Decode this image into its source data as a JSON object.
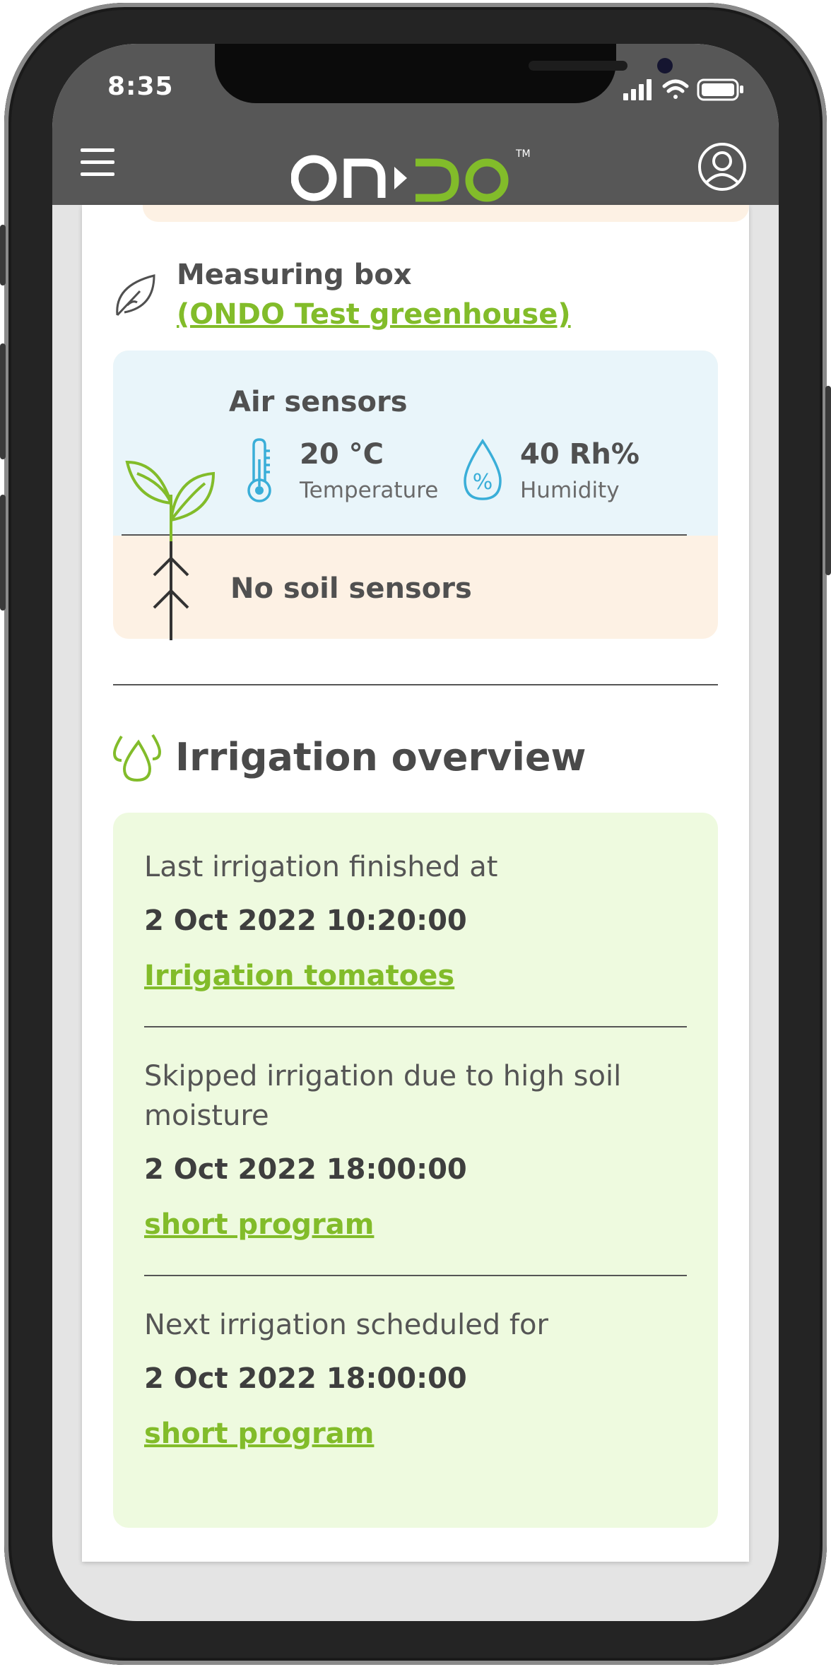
{
  "status_bar": {
    "time": "8:35"
  },
  "header": {
    "logo_text": "ON▸DO™",
    "icons": [
      "hamburger-menu-icon",
      "user-profile-icon"
    ],
    "colors": {
      "bar": "#575757",
      "logo_white": "#ffffff",
      "logo_green": "#82bc2a"
    }
  },
  "measuring_box": {
    "title": "Measuring box",
    "location_link": "(ONDO Test greenhouse)",
    "icon": "leaf-icon"
  },
  "sensors": {
    "air_title": "Air sensors",
    "temperature": {
      "value": "20 °C",
      "label": "Temperature",
      "icon": "thermometer-icon"
    },
    "humidity": {
      "value": "40 Rh%",
      "label": "Humidity",
      "icon": "humidity-drop-icon"
    },
    "soil_text": "No soil sensors",
    "plant_icon": "plant-sprout-icon",
    "colors": {
      "air_bg": "#e9f5fa",
      "soil_bg": "#fdf1e4",
      "icon_blue": "#3aaed8",
      "icon_green": "#82bc2a"
    }
  },
  "irrigation": {
    "title": "Irrigation overview",
    "icon": "water-drops-icon",
    "entries": [
      {
        "text": "Last irrigation finished at",
        "date": "2 Oct 2022 10:20:00",
        "link": "Irrigation tomatoes"
      },
      {
        "text_line1": "Skipped irrigation due to high soil",
        "text_line2": "moisture",
        "date": "2 Oct 2022 18:00:00",
        "link": "short program"
      },
      {
        "text": "Next irrigation scheduled for",
        "date": "2 Oct 2022 18:00:00",
        "link": "short program"
      }
    ],
    "colors": {
      "card_bg": "#eefadf",
      "link": "#82bc2a"
    }
  }
}
